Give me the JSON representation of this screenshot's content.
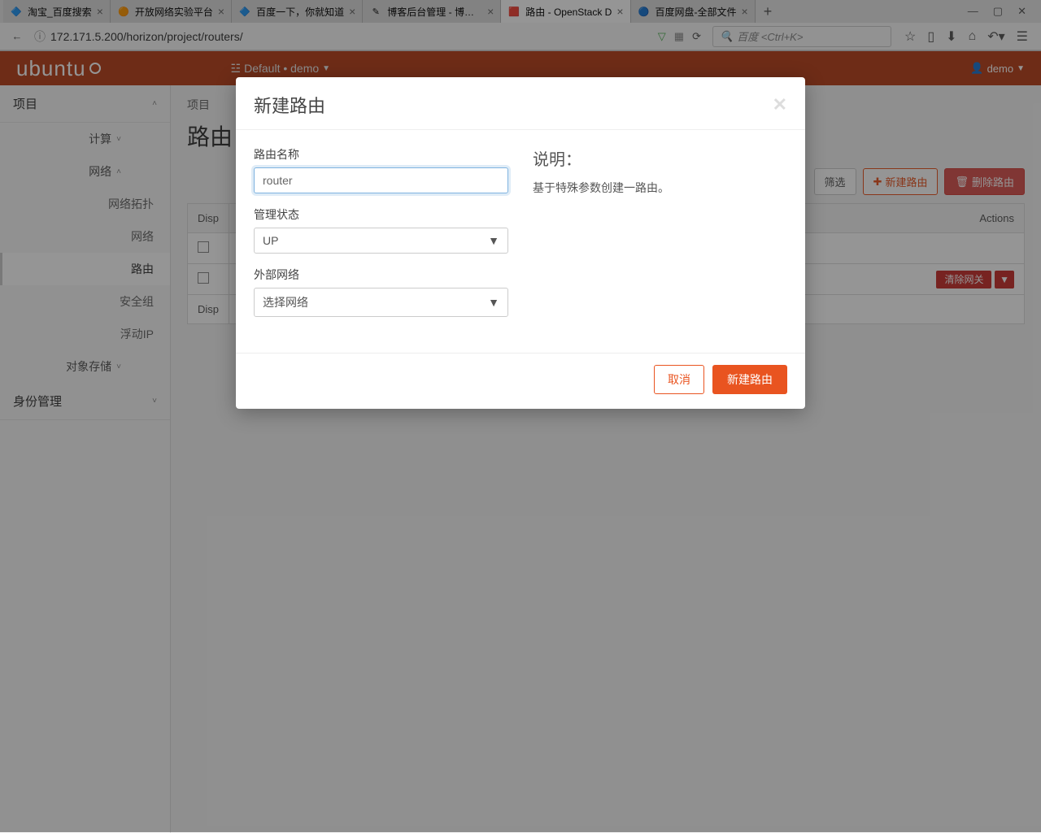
{
  "browser": {
    "tabs": [
      {
        "title": "淘宝_百度搜索",
        "icon": "🔷"
      },
      {
        "title": "开放网络实验平台",
        "icon": "🟠"
      },
      {
        "title": "百度一下，你就知道",
        "icon": "🔷"
      },
      {
        "title": "博客后台管理 - 博客园",
        "icon": "✎"
      },
      {
        "title": "路由 - OpenStack D",
        "icon": "🟥",
        "active": true
      },
      {
        "title": "百度网盘-全部文件",
        "icon": "🔵"
      }
    ],
    "url": "172.171.5.200/horizon/project/routers/",
    "search_placeholder": "百度 <Ctrl+K>"
  },
  "header": {
    "logo": "ubuntu",
    "project": "Default • demo",
    "user": "demo"
  },
  "sidebar": {
    "project": "项目",
    "compute": "计算",
    "network": "网络",
    "items": [
      {
        "label": "网络拓扑"
      },
      {
        "label": "网络"
      },
      {
        "label": "路由",
        "active": true
      },
      {
        "label": "安全组"
      },
      {
        "label": "浮动IP"
      }
    ],
    "object_storage": "对象存储",
    "identity": "身份管理"
  },
  "page": {
    "breadcrumb": "项目",
    "title": "路由",
    "filter": "筛选",
    "create": "新建路由",
    "delete": "删除路由",
    "table": {
      "disp1": "Disp",
      "disp2": "Disp",
      "actions_header": "Actions",
      "row_action": "清除网关"
    }
  },
  "modal": {
    "title": "新建路由",
    "name_label": "路由名称",
    "name_value": "router",
    "admin_label": "管理状态",
    "admin_value": "UP",
    "extnet_label": "外部网络",
    "extnet_value": "选择网络",
    "desc_title": "说明：",
    "desc_text": "基于特殊参数创建一路由。",
    "cancel": "取消",
    "submit": "新建路由"
  }
}
